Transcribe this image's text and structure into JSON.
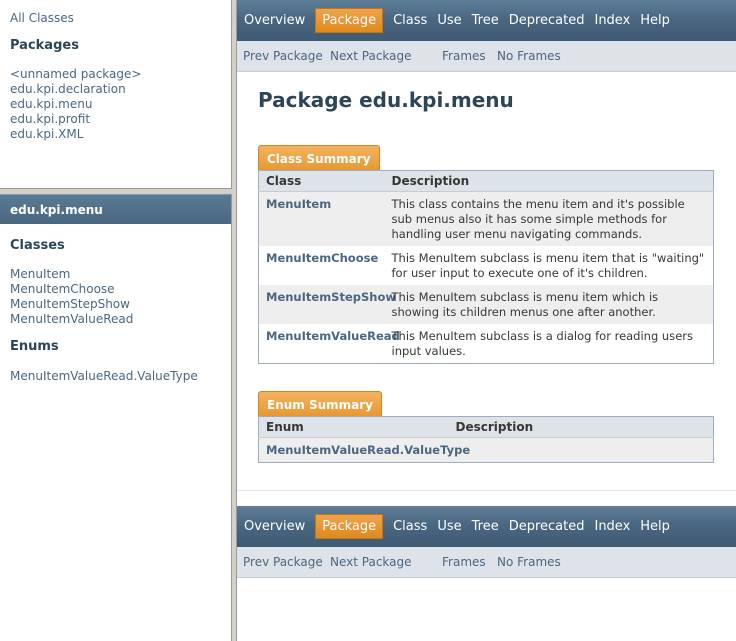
{
  "packages_frame": {
    "all_classes": "All Classes",
    "heading": "Packages",
    "packages": [
      "<unnamed package>",
      "edu.kpi.declaration",
      "edu.kpi.menu",
      "edu.kpi.profit",
      "edu.kpi.XML"
    ]
  },
  "classes_frame": {
    "package_title": "edu.kpi.menu",
    "classes_heading": "Classes",
    "classes": [
      "MenuItem",
      "MenuItemChoose",
      "MenuItemStepShow",
      "MenuItemValueRead"
    ],
    "enums_heading": "Enums",
    "enums": [
      "MenuItemValueRead.ValueType"
    ]
  },
  "nav": {
    "items": [
      "Overview",
      "Package",
      "Class",
      "Use",
      "Tree",
      "Deprecated",
      "Index",
      "Help"
    ],
    "active": "Package",
    "prev_package": "Prev Package",
    "next_package": "Next Package",
    "frames": "Frames",
    "no_frames": "No Frames"
  },
  "main": {
    "title": "Package edu.kpi.menu",
    "class_summary": {
      "caption": "Class Summary",
      "col_class": "Class",
      "col_description": "Description",
      "rows": [
        {
          "name": "MenuItem",
          "description": "This class contains the menu item and it's possible sub menus also it has some simple methods for handling user menu navigating commands."
        },
        {
          "name": "MenuItemChoose",
          "description": "This MenuItem subclass is menu item that is \"waiting\" for user input to execute one of it's children."
        },
        {
          "name": "MenuItemStepShow",
          "description": "This MenuItem subclass is menu item which is showing its children menus one after another."
        },
        {
          "name": "MenuItemValueRead",
          "description": "This MenuItem subclass is a dialog for reading users input values."
        }
      ]
    },
    "enum_summary": {
      "caption": "Enum Summary",
      "col_enum": "Enum",
      "col_description": "Description",
      "rows": [
        {
          "name": "MenuItemValueRead.ValueType",
          "description": ""
        }
      ]
    }
  }
}
